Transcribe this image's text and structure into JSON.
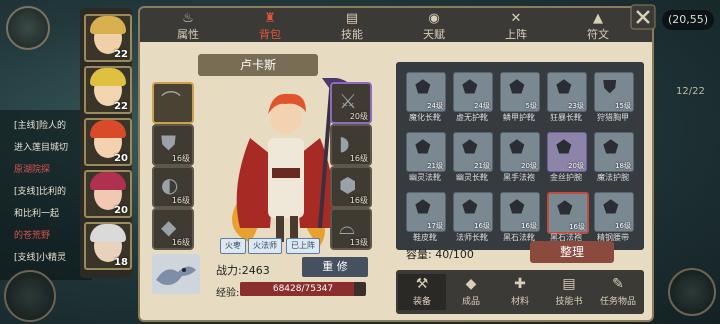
{
  "coords": "(20,55)",
  "page_fraction": "12/22",
  "quests": [
    {
      "text": "[主线]险人的",
      "red": false
    },
    {
      "text": "进入莲目城切",
      "red": false
    },
    {
      "text": "原湖院探",
      "red": true
    },
    {
      "text": "[支线]比利的",
      "red": false
    },
    {
      "text": "和比利一起",
      "red": false
    },
    {
      "text": "的苍荒野",
      "red": true
    },
    {
      "text": "[支线]小精灵",
      "red": false
    }
  ],
  "party": [
    {
      "level": "22",
      "hair": "#d8b050",
      "skin": "#f0d0a8",
      "face": "elf"
    },
    {
      "level": "22",
      "hair": "#e0c040",
      "skin": "#f2d6b0",
      "face": "elf"
    },
    {
      "level": "20",
      "hair": "#d84a2a",
      "skin": "#f4d2b0",
      "face": "red"
    },
    {
      "level": "20",
      "hair": "#b03050",
      "skin": "#f0c8b4",
      "face": "rose"
    },
    {
      "level": "18",
      "hair": "#dadada",
      "skin": "#e8d2bc",
      "face": "old"
    }
  ],
  "tabs": [
    {
      "label": "属性",
      "icon": "fire-icon",
      "glyph": "♨"
    },
    {
      "label": "背包",
      "icon": "backpack-icon",
      "glyph": "♜"
    },
    {
      "label": "技能",
      "icon": "book-icon",
      "glyph": "▤"
    },
    {
      "label": "天赋",
      "icon": "eye-icon",
      "glyph": "◉"
    },
    {
      "label": "上阵",
      "icon": "crossed-swords-icon",
      "glyph": "✕"
    },
    {
      "label": "符文",
      "icon": "banner-icon",
      "glyph": "▲"
    }
  ],
  "hero": {
    "name": "卢卡斯",
    "tags": [
      "火枣",
      "火法师",
      "已上阵"
    ],
    "power_label": "战力:2463",
    "reset_label": "重 修",
    "exp_label": "经验:",
    "exp_text": "68428/75347",
    "exp_fraction": 0.908
  },
  "left_slots": [
    {
      "level": "",
      "glyph": "⌒",
      "gold": true
    },
    {
      "level": "16级",
      "glyph": "⛊",
      "gold": false
    },
    {
      "level": "16级",
      "glyph": "◐",
      "gold": false
    },
    {
      "level": "16级",
      "glyph": "◆",
      "gold": false
    }
  ],
  "right_slots": [
    {
      "level": "20级",
      "glyph": "⚔",
      "purple": true
    },
    {
      "level": "16级",
      "glyph": "◗",
      "purple": false
    },
    {
      "level": "16级",
      "glyph": "⬢",
      "purple": false
    },
    {
      "level": "13级",
      "glyph": "⌓",
      "purple": false
    }
  ],
  "bag": {
    "rows": [
      [
        {
          "name": "魔化长靴",
          "level": "24级",
          "glyph": "⬟",
          "purple": false
        },
        {
          "name": "虚无护靴",
          "level": "24级",
          "glyph": "⬟",
          "purple": false
        },
        {
          "name": "鳞甲护靴",
          "level": "5级",
          "glyph": "⬟",
          "purple": false
        },
        {
          "name": "狂暴长靴",
          "level": "23级",
          "glyph": "⬟",
          "purple": false
        },
        {
          "name": "狩猎胸甲",
          "level": "15级",
          "glyph": "⛊",
          "purple": false
        }
      ],
      [
        {
          "name": "幽灵法靴",
          "level": "21级",
          "glyph": "⬟",
          "purple": false
        },
        {
          "name": "幽灵长靴",
          "level": "21级",
          "glyph": "⬟",
          "purple": false
        },
        {
          "name": "黑手法袍",
          "level": "20级",
          "glyph": "⬟",
          "purple": false
        },
        {
          "name": "金丝护腕",
          "level": "20级",
          "glyph": "⬟",
          "purple": true
        },
        {
          "name": "魔法护腕",
          "level": "18级",
          "glyph": "⬟",
          "purple": false
        }
      ],
      [
        {
          "name": "鞋皮靴",
          "level": "17级",
          "glyph": "⬟",
          "purple": false
        },
        {
          "name": "法师长靴",
          "level": "16级",
          "glyph": "⬟",
          "purple": false
        },
        {
          "name": "黑石法靴",
          "level": "16级",
          "glyph": "⬟",
          "purple": false
        },
        {
          "name": "黑石法袍",
          "level": "16级",
          "glyph": "⬟",
          "purple": false,
          "selected": true
        },
        {
          "name": "精钢腰带",
          "level": "16级",
          "glyph": "⬟",
          "purple": false
        }
      ]
    ],
    "capacity_label": "容量:",
    "capacity_value": "40/100",
    "sort_label": "整理"
  },
  "bottom_tabs": [
    {
      "label": "装备",
      "icon": "hammer-icon",
      "glyph": "⚒",
      "active": true
    },
    {
      "label": "成品",
      "icon": "pouch-icon",
      "glyph": "◆",
      "active": false
    },
    {
      "label": "材料",
      "icon": "materials-icon",
      "glyph": "✚",
      "active": false
    },
    {
      "label": "技能书",
      "icon": "book-icon",
      "glyph": "▤",
      "active": false
    },
    {
      "label": "任务物品",
      "icon": "scroll-icon",
      "glyph": "✎",
      "active": false
    }
  ]
}
